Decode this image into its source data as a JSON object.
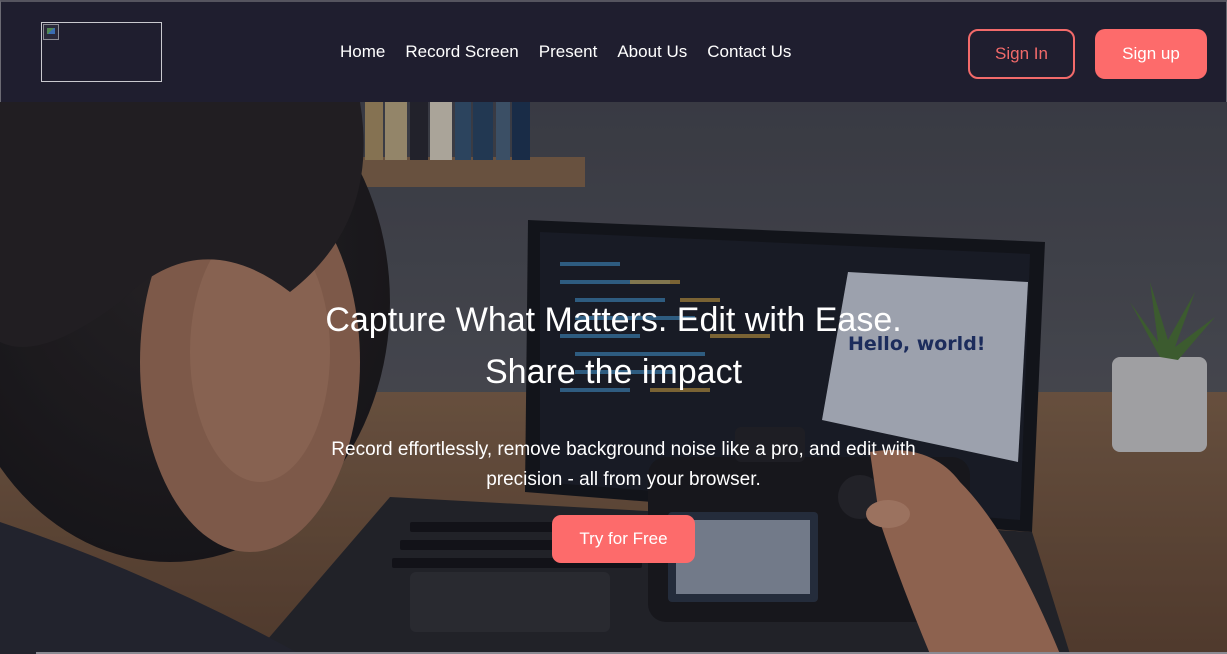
{
  "nav": {
    "links": [
      "Home",
      "Record Screen",
      "Present",
      "About Us",
      "Contact Us"
    ],
    "sign_in": "Sign In",
    "sign_up": "Sign up"
  },
  "hero": {
    "title_line1": "Capture What Matters. Edit with Ease.",
    "title_line2": "Share the impact",
    "subtitle_line1": "Record effortlessly, remove background noise like a pro, and edit with",
    "subtitle_line2": "precision - all from your browser.",
    "cta": "Try for Free",
    "screen_text": "Hello, world!"
  },
  "colors": {
    "nav_bg": "#1f1e2f",
    "accent": "#fd6b6b",
    "text": "#ffffff"
  }
}
